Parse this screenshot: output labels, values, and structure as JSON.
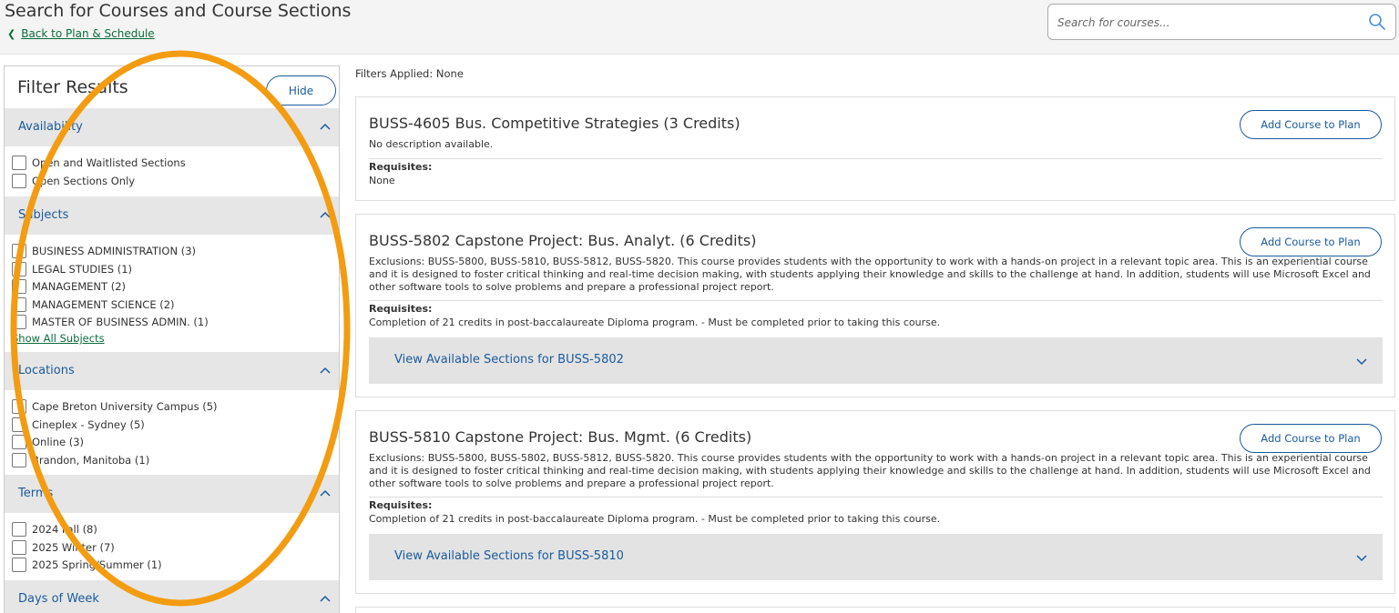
{
  "header": {
    "title": "Search for Courses and Course Sections",
    "back_link": "Back to Plan & Schedule",
    "search_placeholder": "Search for courses..."
  },
  "sidebar": {
    "title": "Filter Results",
    "hide_label": "Hide",
    "sections": {
      "availability": {
        "label": "Availability",
        "options": [
          "Open and Waitlisted Sections",
          "Open Sections Only"
        ]
      },
      "subjects": {
        "label": "Subjects",
        "options": [
          "BUSINESS ADMINISTRATION (3)",
          "LEGAL STUDIES (1)",
          "MANAGEMENT (2)",
          "MANAGEMENT SCIENCE (2)",
          "MASTER OF BUSINESS ADMIN. (1)"
        ],
        "show_all": "Show All Subjects"
      },
      "locations": {
        "label": "Locations",
        "options": [
          "Cape Breton University Campus (5)",
          "Cineplex - Sydney (5)",
          "Online (3)",
          "Brandon, Manitoba (1)"
        ]
      },
      "terms": {
        "label": "Terms",
        "options": [
          "2024 Fall (8)",
          "2025 Winter (7)",
          "2025 Spring/Summer (1)"
        ]
      },
      "days": {
        "label": "Days of Week"
      }
    }
  },
  "main": {
    "filters_applied": "Filters Applied: None",
    "add_label": "Add Course to Plan",
    "requisites_label": "Requisites:",
    "courses": [
      {
        "title": "BUSS-4605 Bus. Competitive Strategies (3 Credits)",
        "description": "No description available.",
        "requisites": "None"
      },
      {
        "title": "BUSS-5802 Capstone Project: Bus. Analyt. (6 Credits)",
        "description": "Exclusions: BUSS-5800, BUSS-5810, BUSS-5812, BUSS-5820. This course provides students with the opportunity to work with a hands-on project in a relevant topic area. This is an experiential course and it is designed to foster critical thinking and real-time decision making, with students applying their knowledge and skills to the challenge at hand. In addition, students will use Microsoft Excel and other software tools to solve problems and prepare a professional project report.",
        "requisites": "Completion of 21 credits in post-baccalaureate Diploma program. - Must be completed prior to taking this course.",
        "sections_label": "View Available Sections for BUSS-5802"
      },
      {
        "title": "BUSS-5810 Capstone Project: Bus. Mgmt. (6 Credits)",
        "description": "Exclusions: BUSS-5800, BUSS-5802, BUSS-5812, BUSS-5820. This course provides students with the opportunity to work with a hands-on project in a relevant topic area. This is an experiential course and it is designed to foster critical thinking and real-time decision making, with students applying their knowledge and skills to the challenge at hand. In addition, students will use Microsoft Excel and other software tools to solve problems and prepare a professional project report.",
        "requisites": "Completion of 21 credits in post-baccalaureate Diploma program. - Must be completed prior to taking this course.",
        "sections_label": "View Available Sections for BUSS-5810"
      }
    ]
  },
  "colors": {
    "accent_blue": "#1a5a9c",
    "link_green": "#0b6b3a",
    "annotation_orange": "#f39c12"
  }
}
